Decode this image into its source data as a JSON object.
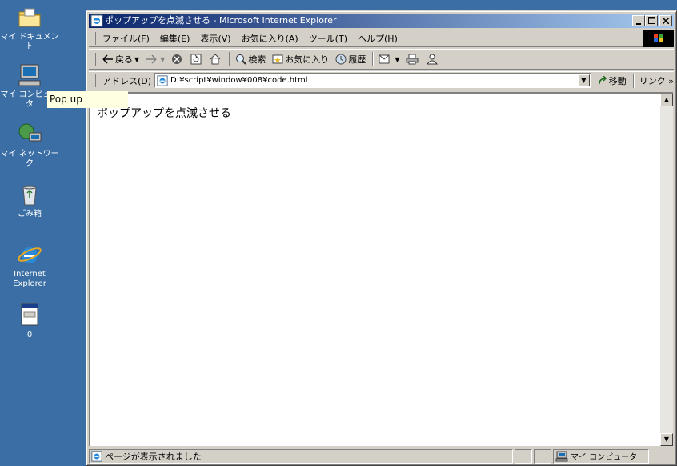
{
  "desktop": {
    "icons": [
      {
        "label": "マイ ドキュメント",
        "icon": "folder-icon"
      },
      {
        "label": "マイ コンピュータ",
        "icon": "computer-icon"
      },
      {
        "label": "マイ ネットワーク",
        "icon": "network-icon"
      },
      {
        "label": "ごみ箱",
        "icon": "recycle-bin-icon"
      },
      {
        "label": "Internet Explorer",
        "icon": "ie-icon"
      },
      {
        "label": "0",
        "icon": "file-icon"
      }
    ]
  },
  "tooltip": {
    "text": "Pop up"
  },
  "window": {
    "title": "ポップアップを点滅させる - Microsoft Internet Explorer",
    "menu": [
      "ファイル(F)",
      "編集(E)",
      "表示(V)",
      "お気に入り(A)",
      "ツール(T)",
      "ヘルプ(H)"
    ],
    "toolbar": {
      "back": "戻る",
      "search": "検索",
      "favorites": "お気に入り",
      "history": "履歴"
    },
    "address": {
      "label": "アドレス(D)",
      "value": "D:¥script¥window¥008¥code.html",
      "go": "移動",
      "links": "リンク"
    },
    "content": {
      "text": "ポップアップを点滅させる"
    },
    "status": {
      "text": "ページが表示されました",
      "zone": "マイ コンピュータ"
    }
  },
  "colors": {
    "desktop": "#3a6ea5",
    "titlebar_start": "#0a246a",
    "titlebar_end": "#a6caf0",
    "chrome": "#d4d0c8",
    "tooltip": "#ffffe1"
  }
}
